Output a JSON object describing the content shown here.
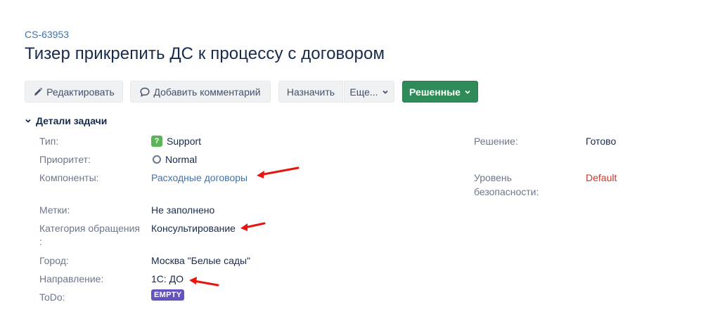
{
  "issue": {
    "key": "CS-63953",
    "summary": "Тизер прикрепить ДС к процессу с договором"
  },
  "toolbar": {
    "edit": "Редактировать",
    "comment": "Добавить комментарий",
    "assign": "Назначить",
    "more": "Еще...",
    "resolved": "Решенные"
  },
  "details": {
    "title": "Детали задачи",
    "type_label": "Тип:",
    "type_value": "Support",
    "priority_label": "Приоритет:",
    "priority_value": "Normal",
    "components_label": "Компоненты:",
    "components_value": "Расходные договоры",
    "labels_label": "Метки:",
    "labels_value": "Не заполнено",
    "category_label_1": "Категория обращения",
    "category_label_2": ":",
    "category_value": "Консультирование",
    "city_label": "Город:",
    "city_value": "Москва \"Белые сады\"",
    "direction_label": "Направление:",
    "direction_value": "1С: ДО",
    "todo_label": "ToDo:",
    "todo_value": "EMPTY",
    "resolution_label": "Решение:",
    "resolution_value": "Готово",
    "security_label_1": "Уровень",
    "security_label_2": "безопасности:",
    "security_value": "Default"
  },
  "colors": {
    "link": "#3b73af",
    "resolved_button": "#2e8b57",
    "lozenge": "#6554c0",
    "annotation_arrow": "#e8140f",
    "security_default": "#c9372c"
  },
  "icons": [
    "pencil-icon",
    "comment-icon",
    "chevron-down-icon",
    "question-icon",
    "circle-icon",
    "arrow-annotation"
  ]
}
